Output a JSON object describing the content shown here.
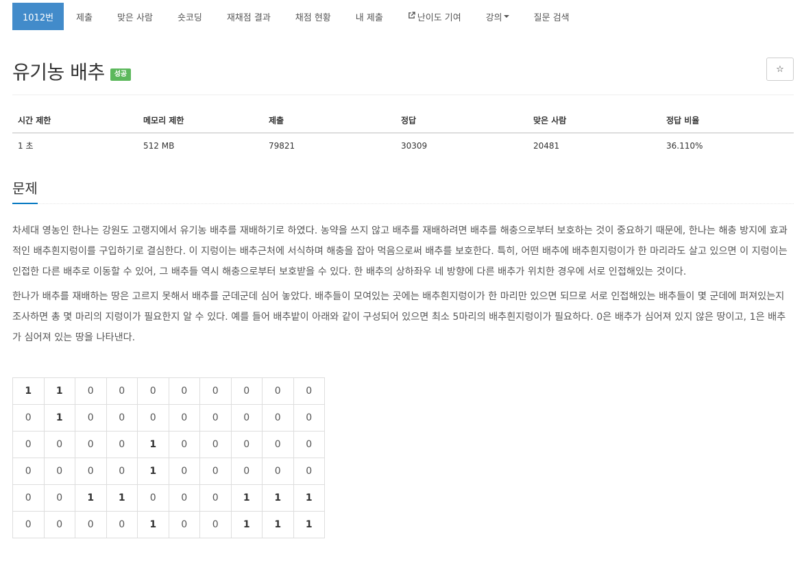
{
  "nav": {
    "items": [
      {
        "label": "1012번",
        "active": true
      },
      {
        "label": "제출"
      },
      {
        "label": "맞은 사람"
      },
      {
        "label": "숏코딩"
      },
      {
        "label": "재채점 결과"
      },
      {
        "label": "채점 현황"
      },
      {
        "label": "내 제출"
      },
      {
        "label": "난이도 기여",
        "icon": "external-link-icon"
      },
      {
        "label": "강의",
        "dropdown": true
      },
      {
        "label": "질문 검색"
      }
    ]
  },
  "problem": {
    "title": "유기농 배추",
    "status_badge": "성공",
    "star_icon": "☆",
    "info": {
      "headers": [
        "시간 제한",
        "메모리 제한",
        "제출",
        "정답",
        "맞은 사람",
        "정답 비율"
      ],
      "values": [
        "1 초",
        "512 MB",
        "79821",
        "30309",
        "20481",
        "36.110%"
      ]
    },
    "section_title": "문제",
    "paragraphs": [
      "차세대 영농인 한나는 강원도 고랭지에서 유기농 배추를 재배하기로 하였다. 농약을 쓰지 않고 배추를 재배하려면 배추를 해충으로부터 보호하는 것이 중요하기 때문에, 한나는 해충 방지에 효과적인 배추흰지렁이를 구입하기로 결심한다. 이 지렁이는 배추근처에 서식하며 해충을 잡아 먹음으로써 배추를 보호한다. 특히, 어떤 배추에 배추흰지렁이가 한 마리라도 살고 있으면 이 지렁이는 인접한 다른 배추로 이동할 수 있어, 그 배추들 역시 해충으로부터 보호받을 수 있다. 한 배추의 상하좌우 네 방향에 다른 배추가 위치한 경우에 서로 인접해있는 것이다.",
      "한나가 배추를 재배하는 땅은 고르지 못해서 배추를 군데군데 심어 놓았다. 배추들이 모여있는 곳에는 배추흰지렁이가 한 마리만 있으면 되므로 서로 인접해있는 배추들이 몇 군데에 퍼져있는지 조사하면 총 몇 마리의 지렁이가 필요한지 알 수 있다. 예를 들어 배추밭이 아래와 같이 구성되어 있으면 최소 5마리의 배추흰지렁이가 필요하다. 0은 배추가 심어져 있지 않은 땅이고, 1은 배추가 심어져 있는 땅을 나타낸다."
    ],
    "grid": [
      [
        1,
        1,
        0,
        0,
        0,
        0,
        0,
        0,
        0,
        0
      ],
      [
        0,
        1,
        0,
        0,
        0,
        0,
        0,
        0,
        0,
        0
      ],
      [
        0,
        0,
        0,
        0,
        1,
        0,
        0,
        0,
        0,
        0
      ],
      [
        0,
        0,
        0,
        0,
        1,
        0,
        0,
        0,
        0,
        0
      ],
      [
        0,
        0,
        1,
        1,
        0,
        0,
        0,
        1,
        1,
        1
      ],
      [
        0,
        0,
        0,
        0,
        1,
        0,
        0,
        1,
        1,
        1
      ]
    ]
  }
}
